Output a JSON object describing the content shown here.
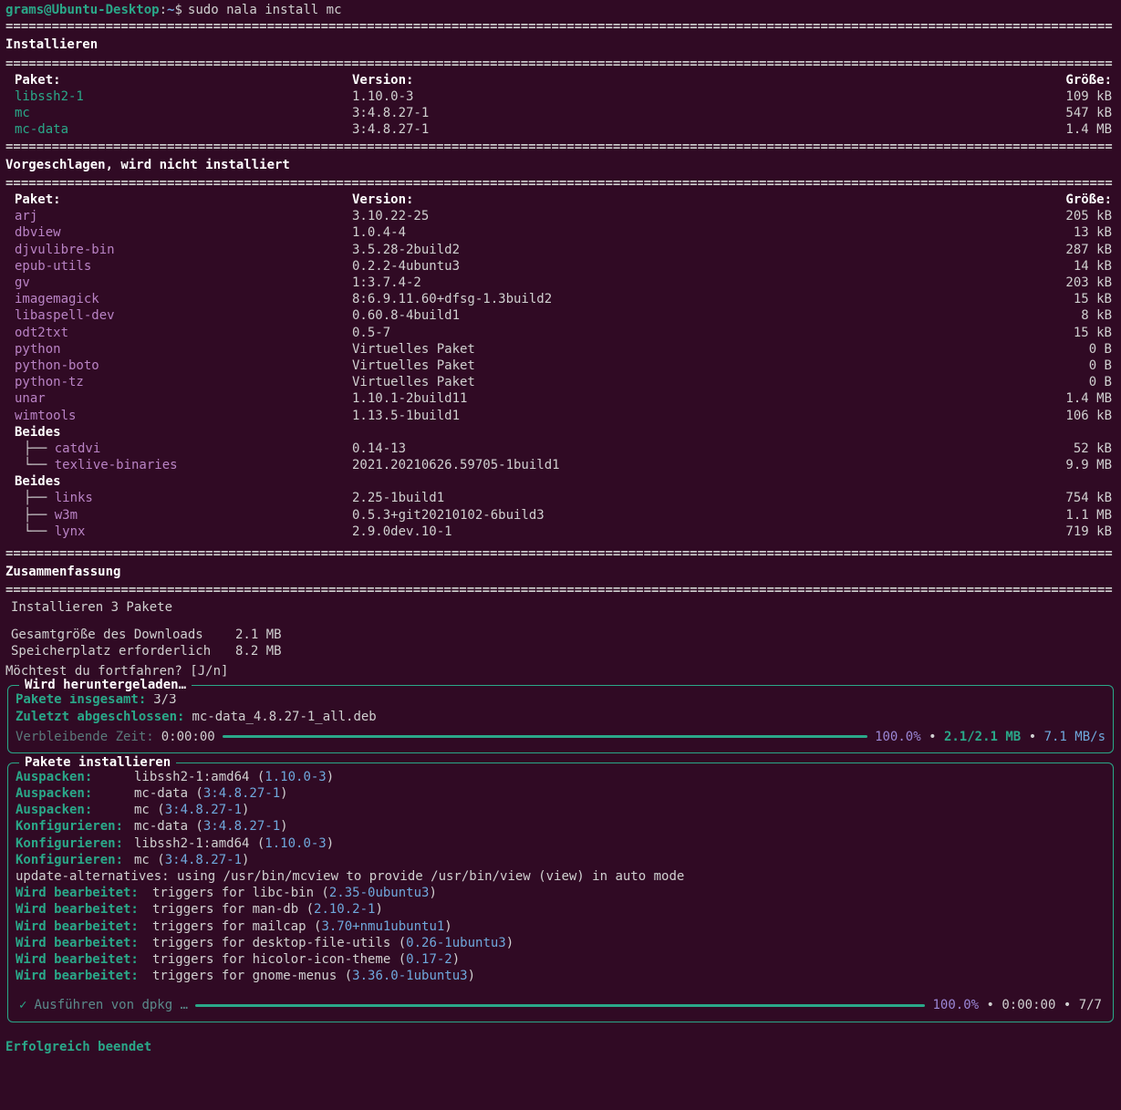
{
  "prompt": {
    "user": "grams",
    "at": "@",
    "host": "Ubuntu-Desktop",
    "colon": ":",
    "path": "~",
    "dollar": "$",
    "command": "sudo nala install mc"
  },
  "rule_line": "================================================================================================================================================",
  "sections": {
    "install": {
      "title": "Installieren",
      "headers": {
        "pkg": "Paket:",
        "ver": "Version:",
        "size": "Größe:"
      },
      "rows": [
        {
          "name": "libssh2-1",
          "ver": "1.10.0-3",
          "size": "109 kB"
        },
        {
          "name": "mc",
          "ver": "3:4.8.27-1",
          "size": "547 kB"
        },
        {
          "name": "mc-data",
          "ver": "3:4.8.27-1",
          "size": "1.4 MB"
        }
      ]
    },
    "suggested": {
      "title": "Vorgeschlagen, wird nicht installiert",
      "headers": {
        "pkg": "Paket:",
        "ver": "Version:",
        "size": "Größe:"
      },
      "rows": [
        {
          "name": "arj",
          "ver": "3.10.22-25",
          "size": "205 kB"
        },
        {
          "name": "dbview",
          "ver": "1.0.4-4",
          "size": "13 kB"
        },
        {
          "name": "djvulibre-bin",
          "ver": "3.5.28-2build2",
          "size": "287 kB"
        },
        {
          "name": "epub-utils",
          "ver": "0.2.2-4ubuntu3",
          "size": "14 kB"
        },
        {
          "name": "gv",
          "ver": "1:3.7.4-2",
          "size": "203 kB"
        },
        {
          "name": "imagemagick",
          "ver": "8:6.9.11.60+dfsg-1.3build2",
          "size": "15 kB"
        },
        {
          "name": "libaspell-dev",
          "ver": "0.60.8-4build1",
          "size": "8 kB"
        },
        {
          "name": "odt2txt",
          "ver": "0.5-7",
          "size": "15 kB"
        },
        {
          "name": "python",
          "ver": "Virtuelles Paket",
          "size": "0 B"
        },
        {
          "name": "python-boto",
          "ver": "Virtuelles Paket",
          "size": "0 B"
        },
        {
          "name": "python-tz",
          "ver": "Virtuelles Paket",
          "size": "0 B"
        },
        {
          "name": "unar",
          "ver": "1.10.1-2build11",
          "size": "1.4 MB"
        },
        {
          "name": "wimtools",
          "ver": "1.13.5-1build1",
          "size": "106 kB"
        }
      ],
      "group1_label": "Beides",
      "group1": [
        {
          "branch": "├── ",
          "name": "catdvi",
          "ver": "0.14-13",
          "size": "52 kB"
        },
        {
          "branch": "└── ",
          "name": "texlive-binaries",
          "ver": "2021.20210626.59705-1build1",
          "size": "9.9 MB"
        }
      ],
      "group2_label": "Beides",
      "group2": [
        {
          "branch": "├── ",
          "name": "links",
          "ver": "2.25-1build1",
          "size": "754 kB"
        },
        {
          "branch": "├── ",
          "name": "w3m",
          "ver": "0.5.3+git20210102-6build3",
          "size": "1.1 MB"
        },
        {
          "branch": "└── ",
          "name": "lynx",
          "ver": "2.9.0dev.10-1",
          "size": "719 kB"
        }
      ]
    }
  },
  "summary": {
    "title": "Zusammenfassung",
    "install_count": "Installieren 3 Pakete",
    "total_label": "Gesamtgröße des Downloads",
    "total_value": "2.1 MB",
    "disk_label": "Speicherplatz erforderlich",
    "disk_value": "8.2 MB"
  },
  "confirm": "Möchtest du fortfahren? [J/n]",
  "download": {
    "title": "Wird heruntergeladen…",
    "total_label": "Pakete insgesamt:",
    "total_value": "3/3",
    "last_label": "Zuletzt abgeschlossen:",
    "last_value": "mc-data_4.8.27-1_all.deb",
    "time_label": "Verbleibende Zeit:",
    "time_value": "0:00:00",
    "pct": "100.0%",
    "amount": "2.1/2.1 MB",
    "speed": "7.1 MB/s",
    "sep": "•"
  },
  "install_panel": {
    "title": "Pakete installieren",
    "ops": [
      {
        "op": "Auspacken:",
        "pkg": "libssh2-1:amd64",
        "ver": "1.10.0-3"
      },
      {
        "op": "Auspacken:",
        "pkg": "mc-data",
        "ver": "3:4.8.27-1"
      },
      {
        "op": "Auspacken:",
        "pkg": "mc",
        "ver": "3:4.8.27-1"
      },
      {
        "op": "Konfigurieren:",
        "pkg": "mc-data",
        "ver": "3:4.8.27-1"
      },
      {
        "op": "Konfigurieren:",
        "pkg": "libssh2-1:amd64",
        "ver": "1.10.0-3"
      },
      {
        "op": "Konfigurieren:",
        "pkg": "mc",
        "ver": "3:4.8.27-1"
      }
    ],
    "alt_line": "update-alternatives: using /usr/bin/mcview to provide /usr/bin/view (view) in auto mode",
    "triggers": [
      {
        "label": "Wird bearbeitet:",
        "text": "triggers for libc-bin",
        "ver": "2.35-0ubuntu3"
      },
      {
        "label": "Wird bearbeitet:",
        "text": "triggers for man-db",
        "ver": "2.10.2-1"
      },
      {
        "label": "Wird bearbeitet:",
        "text": "triggers for mailcap",
        "ver": "3.70+nmu1ubuntu1"
      },
      {
        "label": "Wird bearbeitet:",
        "text": "triggers for desktop-file-utils",
        "ver": "0.26-1ubuntu3"
      },
      {
        "label": "Wird bearbeitet:",
        "text": "triggers for hicolor-icon-theme",
        "ver": "0.17-2"
      },
      {
        "label": "Wird bearbeitet:",
        "text": "triggers for gnome-menus",
        "ver": "3.36.0-1ubuntu3"
      }
    ],
    "dpkg": {
      "check": "✓",
      "label": "Ausführen von dpkg …",
      "pct": "100.0%",
      "time": "0:00:00",
      "count": "7/7",
      "sep": "•"
    }
  },
  "done": "Erfolgreich beendet"
}
